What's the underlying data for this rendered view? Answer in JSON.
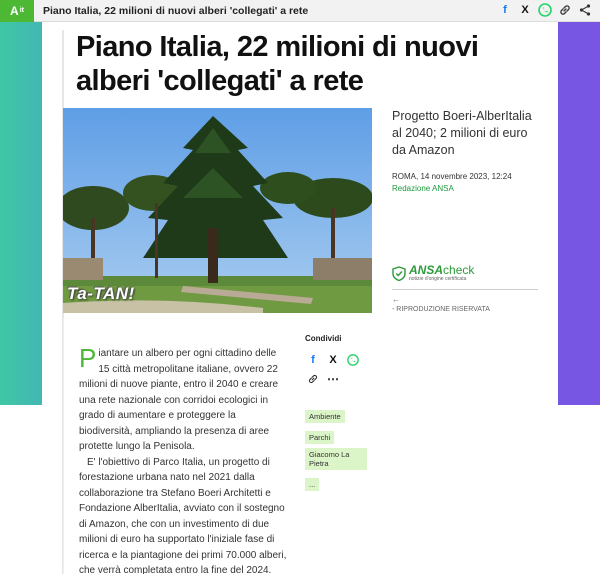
{
  "topbar": {
    "logo": "A",
    "logo_sup": "it",
    "title": "Piano Italia, 22 milioni di nuovi alberi 'collegati' a rete",
    "icons": [
      "facebook-icon",
      "x-icon",
      "whatsapp-icon",
      "link-icon",
      "share-icon"
    ]
  },
  "article": {
    "title": "Piano Italia, 22 milioni di nuovi alberi 'collegati' a rete",
    "subtitle": "Progetto Boeri-AlberItalia al 2040; 2 milioni di euro da Amazon",
    "location": "ROMA,",
    "date": "14 novembre 2023, 12:24",
    "author": "Redazione ANSA",
    "image_caption_overlay": "Ta-TAN!",
    "ansacheck_brand": "ANSA",
    "ansacheck_suffix": "check",
    "ansacheck_tagline": "notizie d'origine certificata",
    "back_arrow": "←",
    "rights": "- RIPRODUZIONE RISERVATA",
    "dropcap": "P",
    "paragraph1": "iantare un albero per ogni cittadino delle 15 città metropolitane italiane, ovvero 22 milioni di nuove piante, entro il 2040 e creare una rete nazionale con corridoi ecologici in grado di aumentare e proteggere la biodiversità, ampliando la presenza di aree protette lungo la Penisola.",
    "paragraph2": "E' l'obiettivo di Parco Italia, un progetto di forestazione urbana nato nel 2021 dalla collaborazione tra Stefano Boeri Architetti e Fondazione AlberItalia, avviato con il sostegno di Amazon, che con un investimento di due milioni di euro ha supportato l'iniziale fase di ricerca e la piantagione dei primi 70.000 alberi, che verrà completata entro la fine del 2024."
  },
  "share": {
    "label": "Condividi",
    "more": "⋯"
  },
  "tags": [
    "Ambiente",
    "Parchi",
    "Giacomo La Pietra",
    "..."
  ],
  "colors": {
    "brand_green": "#4cb833",
    "tag_bg": "#dcf5c8"
  }
}
